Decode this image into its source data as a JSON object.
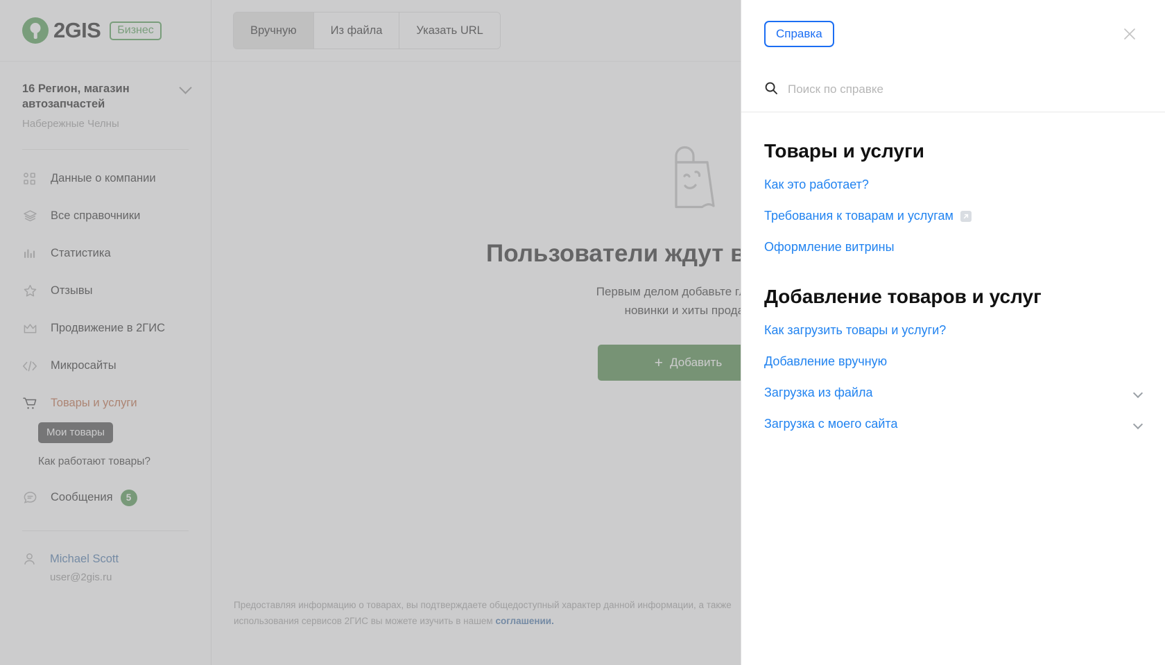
{
  "brand": {
    "logo_text": "2GIS",
    "badge": "Бизнес"
  },
  "org": {
    "name": "16 Регион, магазин автозапчастей",
    "city": "Набережные Челны"
  },
  "sidebar": {
    "items": [
      {
        "label": "Данные о компании",
        "icon": "grid-icon",
        "active": false
      },
      {
        "label": "Все справочники",
        "icon": "layers-icon",
        "active": false
      },
      {
        "label": "Статистика",
        "icon": "bars-icon",
        "active": false
      },
      {
        "label": "Отзывы",
        "icon": "star-icon",
        "active": false
      },
      {
        "label": "Продвижение в 2ГИС",
        "icon": "crown-icon",
        "active": false
      },
      {
        "label": "Микросайты",
        "icon": "code-icon",
        "active": false
      },
      {
        "label": "Товары и услуги",
        "icon": "cart-icon",
        "active": true
      },
      {
        "label": "Сообщения",
        "icon": "chat-icon",
        "active": false,
        "badge": "5"
      }
    ],
    "sub": {
      "current": "Мои товары",
      "link": "Как работают товары?"
    },
    "user": {
      "name": "Michael Scott",
      "email": "user@2gis.ru"
    },
    "active_color": "#f2540b",
    "badge_color": "#1aa01d"
  },
  "topbar": {
    "tabs": [
      {
        "label": "Вручную",
        "selected": true
      },
      {
        "label": "Из файла",
        "selected": false
      },
      {
        "label": "Указать URL",
        "selected": false
      }
    ]
  },
  "main": {
    "illustration": "shopping-bag-smile-icon",
    "title": "Пользователи ждут ваши товары",
    "subtitle_line1": "Первым делом добавьте главные",
    "subtitle_line2": "новинки и хиты продаж",
    "add_button": "Добавить",
    "add_button_plus": "+",
    "add_button_color": "#209113",
    "legal_text": "Предоставляя информацию о товарах, вы подтверждаете общедоступный характер данной информации, а также",
    "legal_text2": "использования сервисов 2ГИС вы можете изучить в нашем ",
    "legal_link": "соглашении."
  },
  "drawer": {
    "tab_label": "Справка",
    "close_icon": "close-icon",
    "search_placeholder": "Поиск по справке",
    "search_value": "",
    "sections": [
      {
        "title": "Товары и услуги",
        "links": [
          {
            "label": "Как это работает?",
            "external": false,
            "expandable": false
          },
          {
            "label": "Требования к товарам и услугам",
            "external": true,
            "expandable": false
          },
          {
            "label": "Оформление витрины",
            "external": false,
            "expandable": false
          }
        ]
      },
      {
        "title": "Добавление товаров и услуг",
        "links": [
          {
            "label": "Как загрузить товары и услуги?",
            "external": false,
            "expandable": false
          },
          {
            "label": "Добавление вручную",
            "external": false,
            "expandable": false
          },
          {
            "label": "Загрузка из файла",
            "external": false,
            "expandable": true
          },
          {
            "label": "Загрузка с моего сайта",
            "external": false,
            "expandable": true
          }
        ]
      }
    ],
    "link_color": "#2183f0",
    "accent_color": "#1b6ef3"
  }
}
